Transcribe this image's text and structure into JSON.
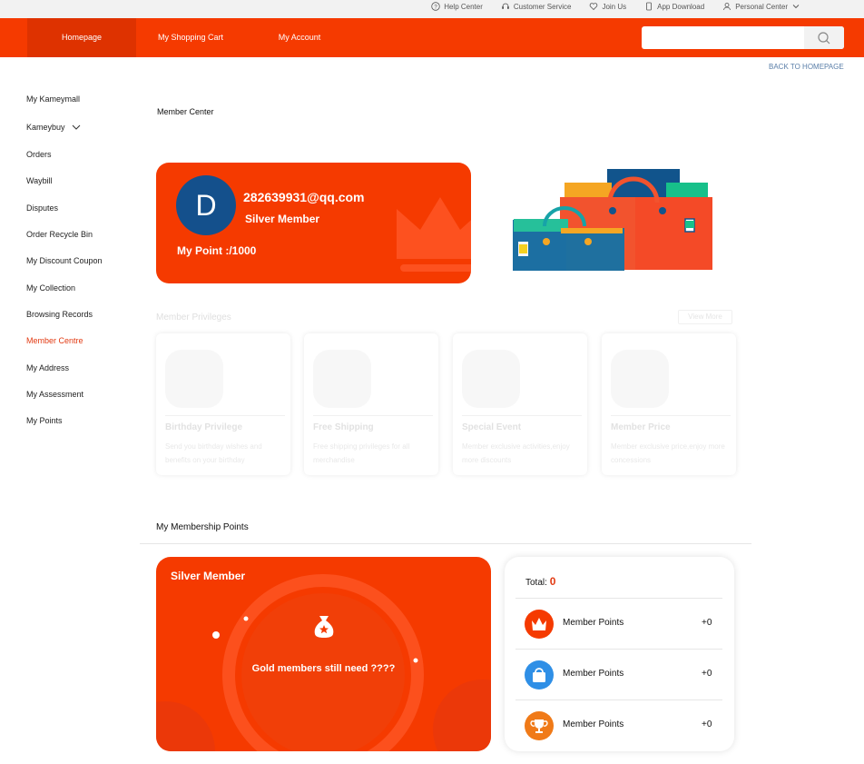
{
  "topbar": {
    "links": [
      {
        "label": "Help Center",
        "icon": "help-icon"
      },
      {
        "label": "Customer Service",
        "icon": "headset-icon"
      },
      {
        "label": "Join Us",
        "icon": "heart-icon"
      },
      {
        "label": "App Download",
        "icon": "phone-icon"
      },
      {
        "label": "Personal Center",
        "icon": "user-icon"
      }
    ]
  },
  "nav": {
    "home": "Homepage",
    "cart": "My Shopping Cart",
    "account": "My Account",
    "search_placeholder": ""
  },
  "back_link": "BACK TO HOMEPAGE",
  "sidebar": {
    "items": [
      {
        "label": "My Kameymall"
      },
      {
        "label": "Kameybuy"
      },
      {
        "label": "Orders"
      },
      {
        "label": "Waybill"
      },
      {
        "label": "Disputes"
      },
      {
        "label": "Order Recycle Bin"
      },
      {
        "label": "My Discount Coupon"
      },
      {
        "label": "My Collection"
      },
      {
        "label": "Browsing Records"
      },
      {
        "label": "Member Centre"
      },
      {
        "label": "My Address"
      },
      {
        "label": "My Assessment"
      },
      {
        "label": "My Points"
      }
    ],
    "active_color": "#e23a12"
  },
  "member_center": {
    "title": "Member Center",
    "avatar_letter": "D",
    "email": "282639931@qq.com",
    "level": "Silver Member",
    "points": "My Point :/1000"
  },
  "privileges": {
    "title": "Member Privileges",
    "view_more": "View More",
    "items": [
      {
        "name": "Birthday Privilege",
        "desc": "Send you birthday wishes and benefits on your birthday"
      },
      {
        "name": "Free Shipping",
        "desc": "Free shipping privileges for all merchandise"
      },
      {
        "name": "Special Event",
        "desc": "Member exclusive activities,enjoy more discounts"
      },
      {
        "name": "Member Price",
        "desc": "Member exclusive price,enjoy more concessions"
      }
    ]
  },
  "membership_points": {
    "title": "My Membership Points",
    "card_level": "Silver Member",
    "card_text": "Gold members still need ????",
    "total_label": "Total:",
    "total_value": "0",
    "rows": [
      {
        "name": "Member Points",
        "value": "+0",
        "icon": "crown-icon",
        "color": "#f53a00"
      },
      {
        "name": "Member Points",
        "value": "+0",
        "icon": "bag-icon",
        "color": "#2f8fe6"
      },
      {
        "name": "Member Points",
        "value": "+0",
        "icon": "trophy-icon",
        "color": "#f07a18"
      }
    ]
  },
  "colors": {
    "brand": "#f53a00",
    "nav_active": "#de3200"
  }
}
